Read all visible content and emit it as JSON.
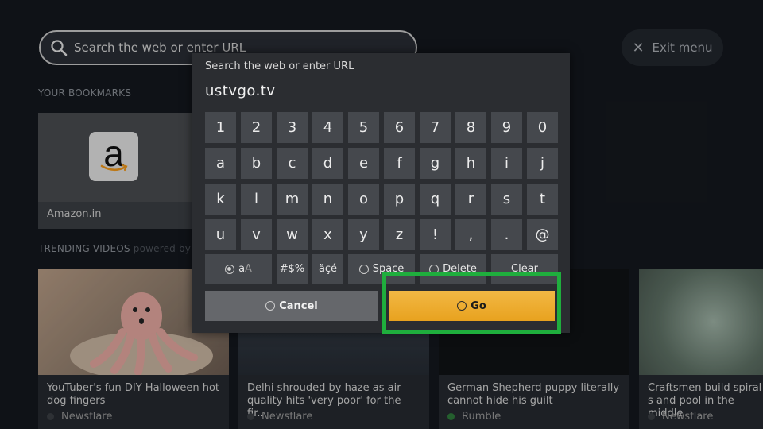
{
  "search_bar": {
    "placeholder": "Search the web or enter URL",
    "icon": "search-icon"
  },
  "exit_menu": {
    "label": "Exit menu",
    "icon": "close-icon"
  },
  "bookmarks": {
    "heading": "YOUR BOOKMARKS",
    "items": [
      {
        "label": "Amazon.in",
        "logo_letter": "a"
      }
    ]
  },
  "trending": {
    "heading": "TRENDING VIDEOS",
    "powered_by": "powered by",
    "videos": [
      {
        "title": "YouTuber's fun DIY Halloween hot dog fingers",
        "source": "Newsflare"
      },
      {
        "title": "Delhi shrouded by haze as air quality hits 'very poor' for the fir...",
        "source": "Newsflare"
      },
      {
        "title": "German Shepherd puppy literally cannot hide his guilt",
        "source": "Rumble"
      },
      {
        "title": "Craftsmen build spiral s and pool in the middle",
        "source": "Newsflare"
      }
    ]
  },
  "keyboard": {
    "prompt": "Search the web or enter URL",
    "input_value": "ustvgo.tv",
    "rows": [
      [
        "1",
        "2",
        "3",
        "4",
        "5",
        "6",
        "7",
        "8",
        "9",
        "0"
      ],
      [
        "a",
        "b",
        "c",
        "d",
        "e",
        "f",
        "g",
        "h",
        "i",
        "j"
      ],
      [
        "k",
        "l",
        "m",
        "n",
        "o",
        "p",
        "q",
        "r",
        "s",
        "t"
      ],
      [
        "u",
        "v",
        "w",
        "x",
        "y",
        "z",
        "!",
        ",",
        ".",
        "@"
      ]
    ],
    "function_keys": {
      "case_main": "a",
      "case_alt": "A",
      "symbols": "#$%",
      "accents": "äçé",
      "space": "Space",
      "delete": "Delete",
      "clear": "Clear"
    },
    "cancel_label": "Cancel",
    "go_label": "Go"
  },
  "colors": {
    "go_button": "#eead33",
    "highlight_box": "#1fae3d",
    "background": "#14181e"
  }
}
